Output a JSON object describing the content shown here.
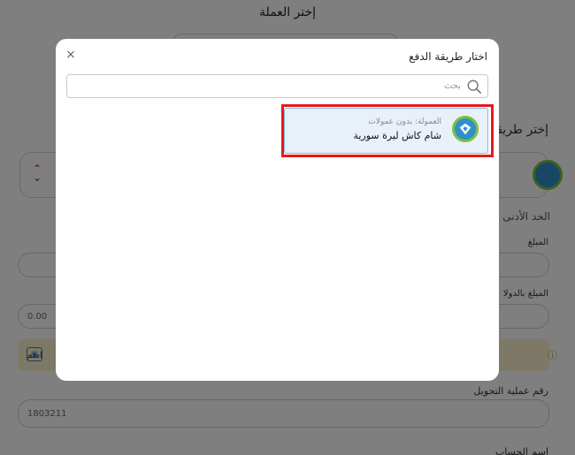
{
  "background": {
    "title": "إختر العملة",
    "payment_method_label": "إختر طريقة",
    "min_limit_label": "الحد الأدنى",
    "amount_label": "المبلغ",
    "amount_usd_label": "المبلغ بالدولا",
    "amount_usd_value": "0.00",
    "warning_text": "اسم",
    "transfer_number_label": "رقم عملية التحويل",
    "transfer_number_value": "1803211",
    "account_name_label": "اسم الحساب"
  },
  "modal": {
    "title": "اختار طريقة الدفع",
    "close_glyph": "×",
    "search_placeholder": "بحث",
    "options": [
      {
        "fee_text": "العمولة: بدون عمولات",
        "name": "شام كاش ليرة سورية",
        "selected": true
      }
    ]
  },
  "colors": {
    "highlight": "#e31b1b",
    "option_bg": "#e8f0fa",
    "logo_blue": "#2f8fc8",
    "logo_green": "#7bc043"
  }
}
